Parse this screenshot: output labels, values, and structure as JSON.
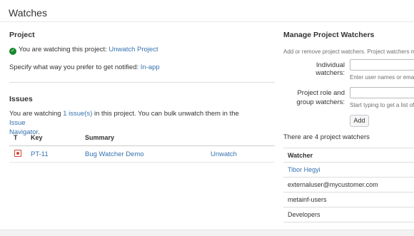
{
  "page": {
    "title": "Watches"
  },
  "project": {
    "heading": "Project",
    "watching_text": "You are watching this project:",
    "unwatch_link": "Unwatch Project",
    "notify_text": "Specify what way you prefer to get notified:",
    "notify_link": "In-app"
  },
  "issues": {
    "heading": "Issues",
    "watching_prefix": "You are watching",
    "count_link": "1 issue(s)",
    "watching_mid": "in this project. You can bulk unwatch them in the",
    "navigator_link_1": "Issue",
    "navigator_link_2": "Navigator",
    "columns": {
      "type": "T",
      "key": "Key",
      "summary": "Summary"
    },
    "rows": [
      {
        "type_icon": "bug-icon",
        "key": "PT-11",
        "summary": "Bug Watcher Demo",
        "action": "Unwatch"
      }
    ]
  },
  "manage": {
    "heading": "Manage Project Watchers",
    "description": "Add or remove project watchers. Project watchers ma",
    "individual_label": "Individual watchers:",
    "individual_hint": "Enter user names or emai",
    "group_label_1": "Project role and",
    "group_label_2": "group watchers:",
    "group_hint": "Start typing to get a list of p",
    "add_button": "Add",
    "count_text": "There are 4 project watchers",
    "watcher_column": "Watcher",
    "watchers": [
      {
        "name": "Tibor Hegyi",
        "is_link": true
      },
      {
        "name": "externaluser@mycustomer.com",
        "is_link": false
      },
      {
        "name": "metainf-users",
        "is_link": false
      },
      {
        "name": "Developers",
        "is_link": false
      }
    ]
  },
  "colors": {
    "link": "#3572b0",
    "success": "#14892c",
    "bug": "#d04437"
  }
}
